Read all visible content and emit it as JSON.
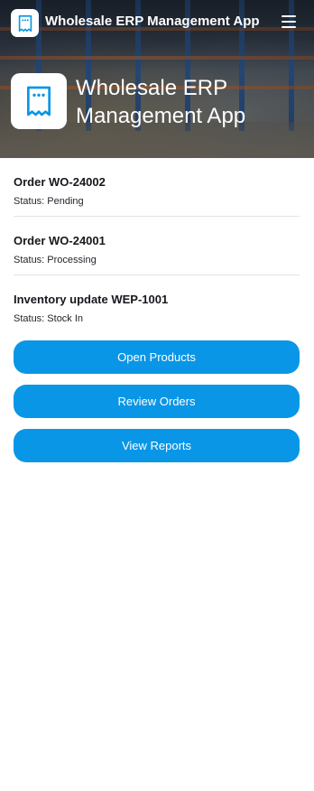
{
  "header": {
    "app_title": "Wholesale ERP Management App",
    "hero_title": "Wholesale ERP Management App",
    "menu_icon": "hamburger-menu-icon",
    "app_icon": "receipt-icon",
    "accent_color": "#0a96e6"
  },
  "activity": [
    {
      "title": "Order WO-24002",
      "status": "Status: Pending"
    },
    {
      "title": "Order WO-24001",
      "status": "Status: Processing"
    },
    {
      "title": "Inventory update WEP-1001",
      "status": "Status: Stock In"
    }
  ],
  "actions": {
    "open_products": "Open Products",
    "review_orders": "Review Orders",
    "view_reports": "View Reports"
  }
}
